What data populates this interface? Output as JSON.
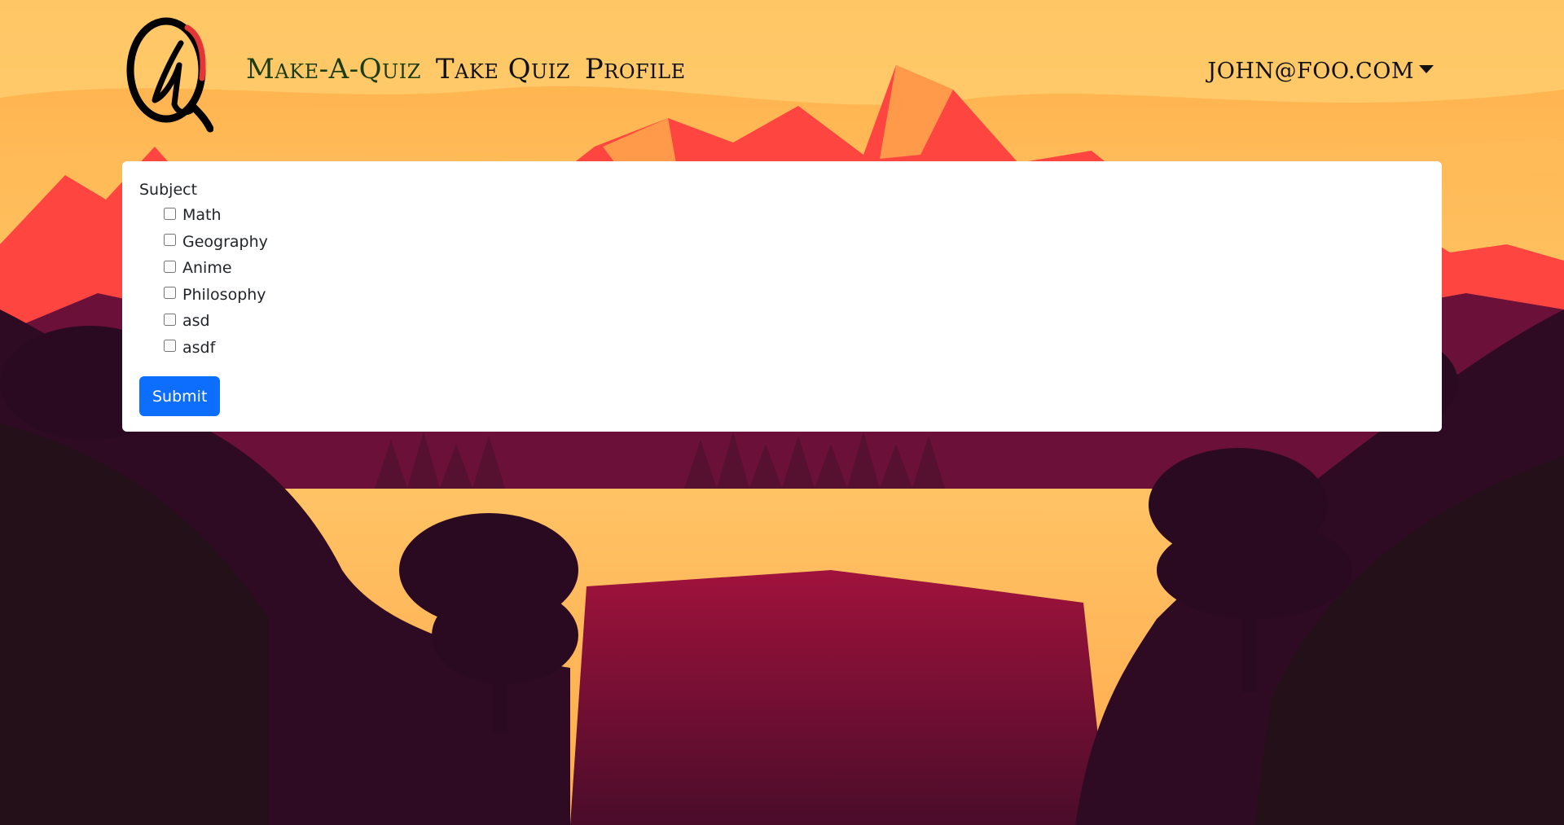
{
  "header": {
    "nav": [
      {
        "label": "Make-A-Quiz",
        "active": true
      },
      {
        "label": "Take Quiz",
        "active": false
      },
      {
        "label": "Profile",
        "active": false
      }
    ],
    "user_email": "john@foo.com"
  },
  "form": {
    "subject_label": "Subject",
    "options": [
      "Math",
      "Geography",
      "Anime",
      "Philosophy",
      "asd",
      "asdf"
    ],
    "submit_label": "Submit"
  },
  "colors": {
    "primary": "#0d6efd",
    "sky": "#ffc25e",
    "mountain": "#ff4040",
    "forest": "#2a0f22"
  }
}
